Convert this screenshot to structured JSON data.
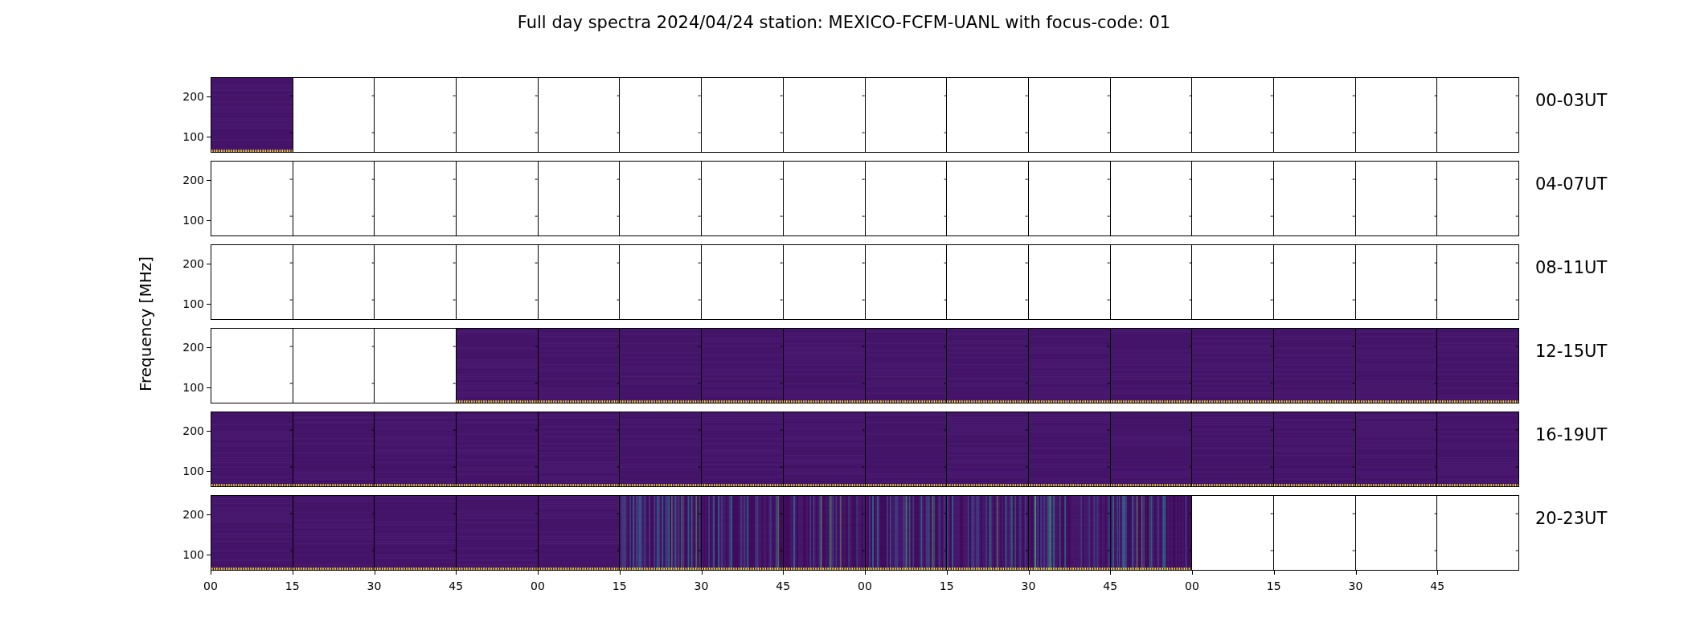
{
  "title": "Full day spectra 2024/04/24 station: MEXICO-FCFM-UANL with focus-code: 01",
  "ylabel": "Frequency [MHz]",
  "xticks": [
    "00",
    "15",
    "30",
    "45",
    "00",
    "15",
    "30",
    "45",
    "00",
    "15",
    "30",
    "45",
    "00",
    "15",
    "30",
    "45"
  ],
  "rows": [
    {
      "label": "00-03UT",
      "yticks": [
        "200",
        "100"
      ],
      "panels": [
        {
          "kind": "quiet"
        },
        {
          "kind": "empty"
        },
        {
          "kind": "empty"
        },
        {
          "kind": "empty"
        },
        {
          "kind": "empty"
        },
        {
          "kind": "empty"
        },
        {
          "kind": "empty"
        },
        {
          "kind": "empty"
        },
        {
          "kind": "empty"
        },
        {
          "kind": "empty"
        },
        {
          "kind": "empty"
        },
        {
          "kind": "empty"
        },
        {
          "kind": "empty"
        },
        {
          "kind": "empty"
        },
        {
          "kind": "empty"
        },
        {
          "kind": "empty"
        }
      ]
    },
    {
      "label": "04-07UT",
      "yticks": [
        "200",
        "100"
      ],
      "panels": [
        {
          "kind": "empty"
        },
        {
          "kind": "empty"
        },
        {
          "kind": "empty"
        },
        {
          "kind": "empty"
        },
        {
          "kind": "empty"
        },
        {
          "kind": "empty"
        },
        {
          "kind": "empty"
        },
        {
          "kind": "empty"
        },
        {
          "kind": "empty"
        },
        {
          "kind": "empty"
        },
        {
          "kind": "empty"
        },
        {
          "kind": "empty"
        },
        {
          "kind": "empty"
        },
        {
          "kind": "empty"
        },
        {
          "kind": "empty"
        },
        {
          "kind": "empty"
        }
      ]
    },
    {
      "label": "08-11UT",
      "yticks": [
        "200",
        "100"
      ],
      "panels": [
        {
          "kind": "empty"
        },
        {
          "kind": "empty"
        },
        {
          "kind": "empty"
        },
        {
          "kind": "empty"
        },
        {
          "kind": "empty"
        },
        {
          "kind": "empty"
        },
        {
          "kind": "empty"
        },
        {
          "kind": "empty"
        },
        {
          "kind": "empty"
        },
        {
          "kind": "empty"
        },
        {
          "kind": "empty"
        },
        {
          "kind": "empty"
        },
        {
          "kind": "empty"
        },
        {
          "kind": "empty"
        },
        {
          "kind": "empty"
        },
        {
          "kind": "empty"
        }
      ]
    },
    {
      "label": "12-15UT",
      "yticks": [
        "200",
        "100"
      ],
      "panels": [
        {
          "kind": "empty"
        },
        {
          "kind": "empty"
        },
        {
          "kind": "empty"
        },
        {
          "kind": "quiet"
        },
        {
          "kind": "quiet"
        },
        {
          "kind": "quiet"
        },
        {
          "kind": "quiet"
        },
        {
          "kind": "quiet"
        },
        {
          "kind": "quiet"
        },
        {
          "kind": "quiet"
        },
        {
          "kind": "quiet"
        },
        {
          "kind": "quiet"
        },
        {
          "kind": "quiet"
        },
        {
          "kind": "quiet"
        },
        {
          "kind": "quiet"
        },
        {
          "kind": "quiet"
        }
      ]
    },
    {
      "label": "16-19UT",
      "yticks": [
        "200",
        "100"
      ],
      "panels": [
        {
          "kind": "quiet"
        },
        {
          "kind": "quiet"
        },
        {
          "kind": "quiet"
        },
        {
          "kind": "quiet"
        },
        {
          "kind": "quiet"
        },
        {
          "kind": "quiet"
        },
        {
          "kind": "quiet"
        },
        {
          "kind": "quiet"
        },
        {
          "kind": "quiet"
        },
        {
          "kind": "quiet"
        },
        {
          "kind": "quiet"
        },
        {
          "kind": "quiet"
        },
        {
          "kind": "quiet"
        },
        {
          "kind": "quiet"
        },
        {
          "kind": "quiet"
        },
        {
          "kind": "quiet"
        }
      ]
    },
    {
      "label": "20-23UT",
      "yticks": [
        "200",
        "100"
      ],
      "panels": [
        {
          "kind": "quiet"
        },
        {
          "kind": "quiet"
        },
        {
          "kind": "quiet"
        },
        {
          "kind": "quiet"
        },
        {
          "kind": "quiet"
        },
        {
          "kind": "burst"
        },
        {
          "kind": "burst"
        },
        {
          "kind": "burst"
        },
        {
          "kind": "burst"
        },
        {
          "kind": "burst"
        },
        {
          "kind": "burst"
        },
        {
          "kind": "burst"
        },
        {
          "kind": "empty"
        },
        {
          "kind": "empty"
        },
        {
          "kind": "empty"
        },
        {
          "kind": "empty"
        }
      ]
    }
  ]
}
